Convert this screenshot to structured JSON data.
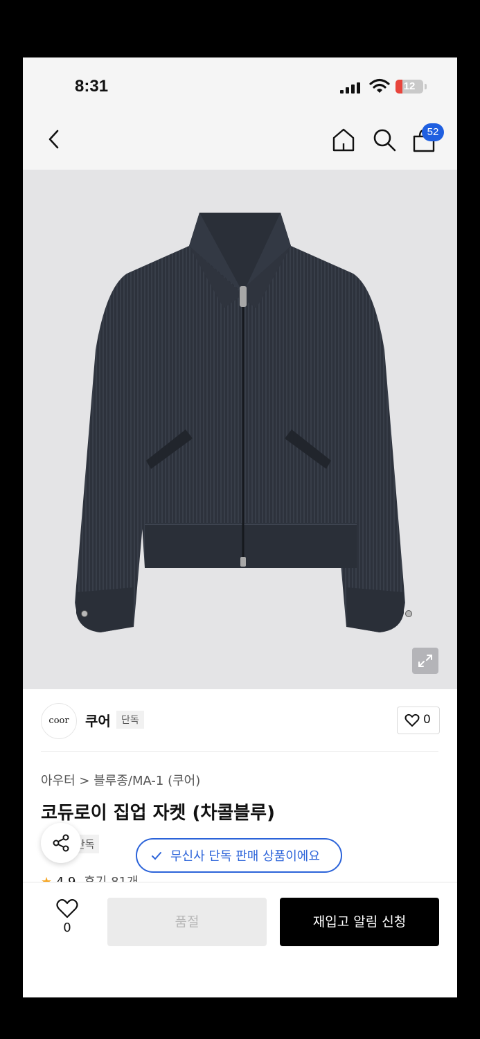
{
  "status_bar": {
    "time": "8:31",
    "battery": "12"
  },
  "nav": {
    "cart_count": "52"
  },
  "brand": {
    "logo_text": "coor",
    "name": "쿠어",
    "tag": "단독",
    "like_count": "0"
  },
  "product": {
    "breadcrumb": "아우터 > 블루종/MA-1 (쿠어)",
    "title": "코듀로이 집업 자켓 (차콜블루)",
    "tag": "단독",
    "rating": "4.9",
    "reviews": "후기 81개"
  },
  "toast": {
    "message": "무신사 단독 판매 상품이에요"
  },
  "bottom": {
    "wish_count": "0",
    "soldout_label": "품절",
    "restock_label": "재입고 알림 신청"
  },
  "colors": {
    "accent": "#2b63d9",
    "badge": "#1f5fe0",
    "star": "#f6a623"
  }
}
